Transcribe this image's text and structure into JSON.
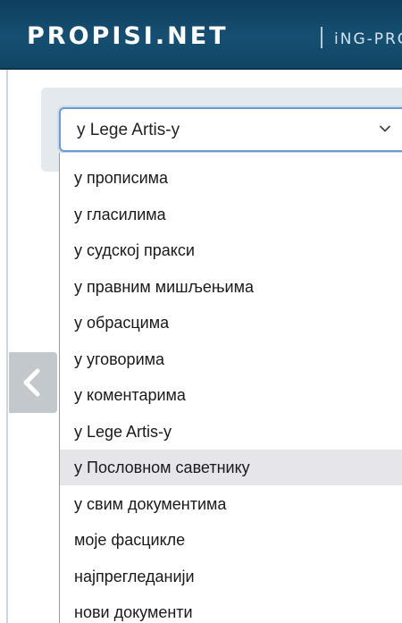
{
  "header": {
    "logo": "PROPISI.NET",
    "sub_brand": "iNG-PRO"
  },
  "search": {
    "selected_value": "у Lege Artis-у",
    "options": [
      {
        "label": "у прописима"
      },
      {
        "label": "у гласилима"
      },
      {
        "label": "у судској пракси"
      },
      {
        "label": "у правним мишљењима"
      },
      {
        "label": "у обрасцима"
      },
      {
        "label": "у уговорима"
      },
      {
        "label": "у коментарима"
      },
      {
        "label": "у Lege Artis-у"
      },
      {
        "label": "у Пословном саветнику",
        "highlighted": true
      },
      {
        "label": "у свим документима"
      },
      {
        "label": "моје фасцикле"
      },
      {
        "label": "најпрегледанији"
      },
      {
        "label": "нови документи"
      }
    ]
  },
  "icons": {
    "select_chevron": "chevron-down-icon",
    "back_tab": "chevron-left-icon"
  },
  "colors": {
    "header_bg": "#164f72",
    "select_border": "#6c9ad3",
    "highlight_bg": "#e5e5ea"
  }
}
